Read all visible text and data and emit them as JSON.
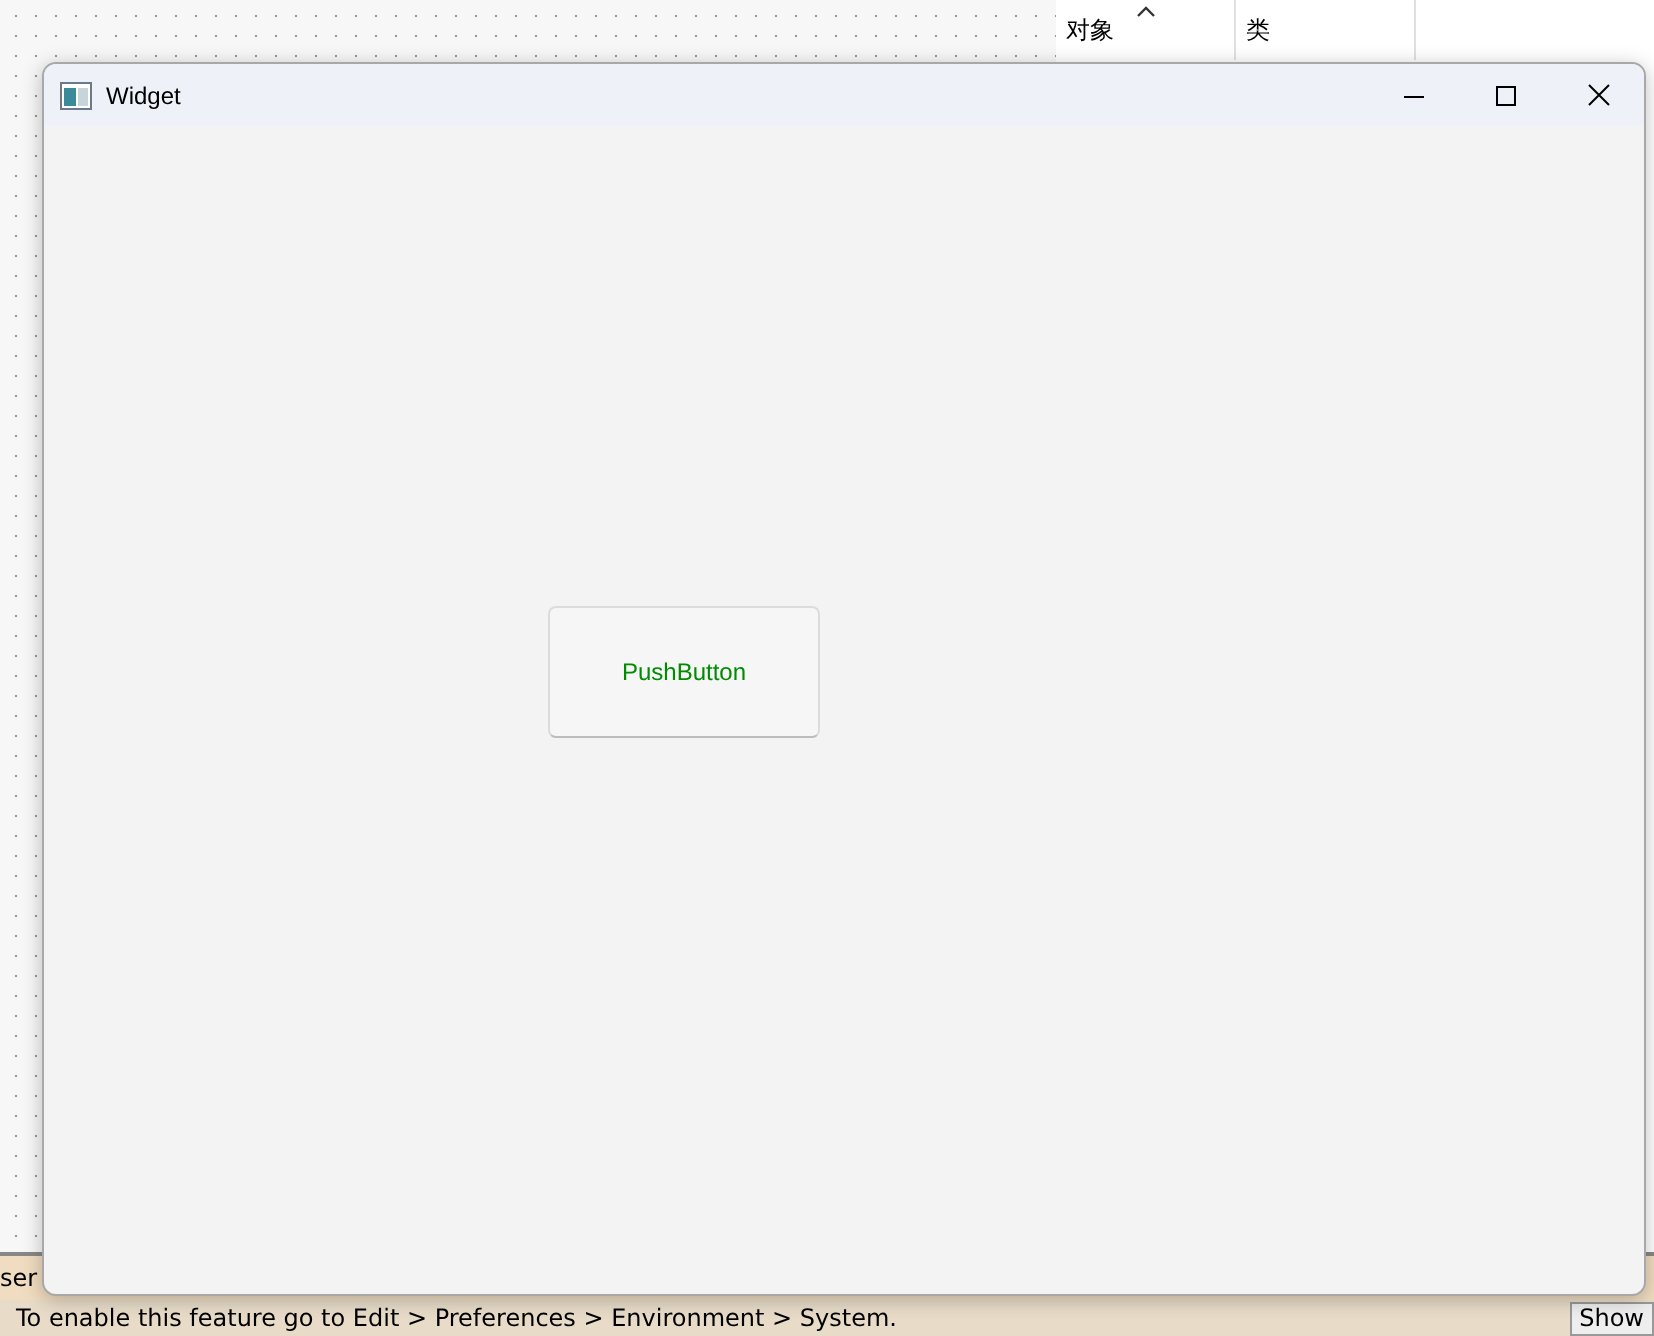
{
  "background": {
    "object_panel": {
      "columns": [
        "对象",
        "类"
      ]
    },
    "left_tab": "ser",
    "status_message": "To enable this feature go to Edit > Preferences > Environment > System.",
    "status_button": "Show"
  },
  "window": {
    "title": "Widget",
    "button": {
      "label": "PushButton"
    }
  }
}
